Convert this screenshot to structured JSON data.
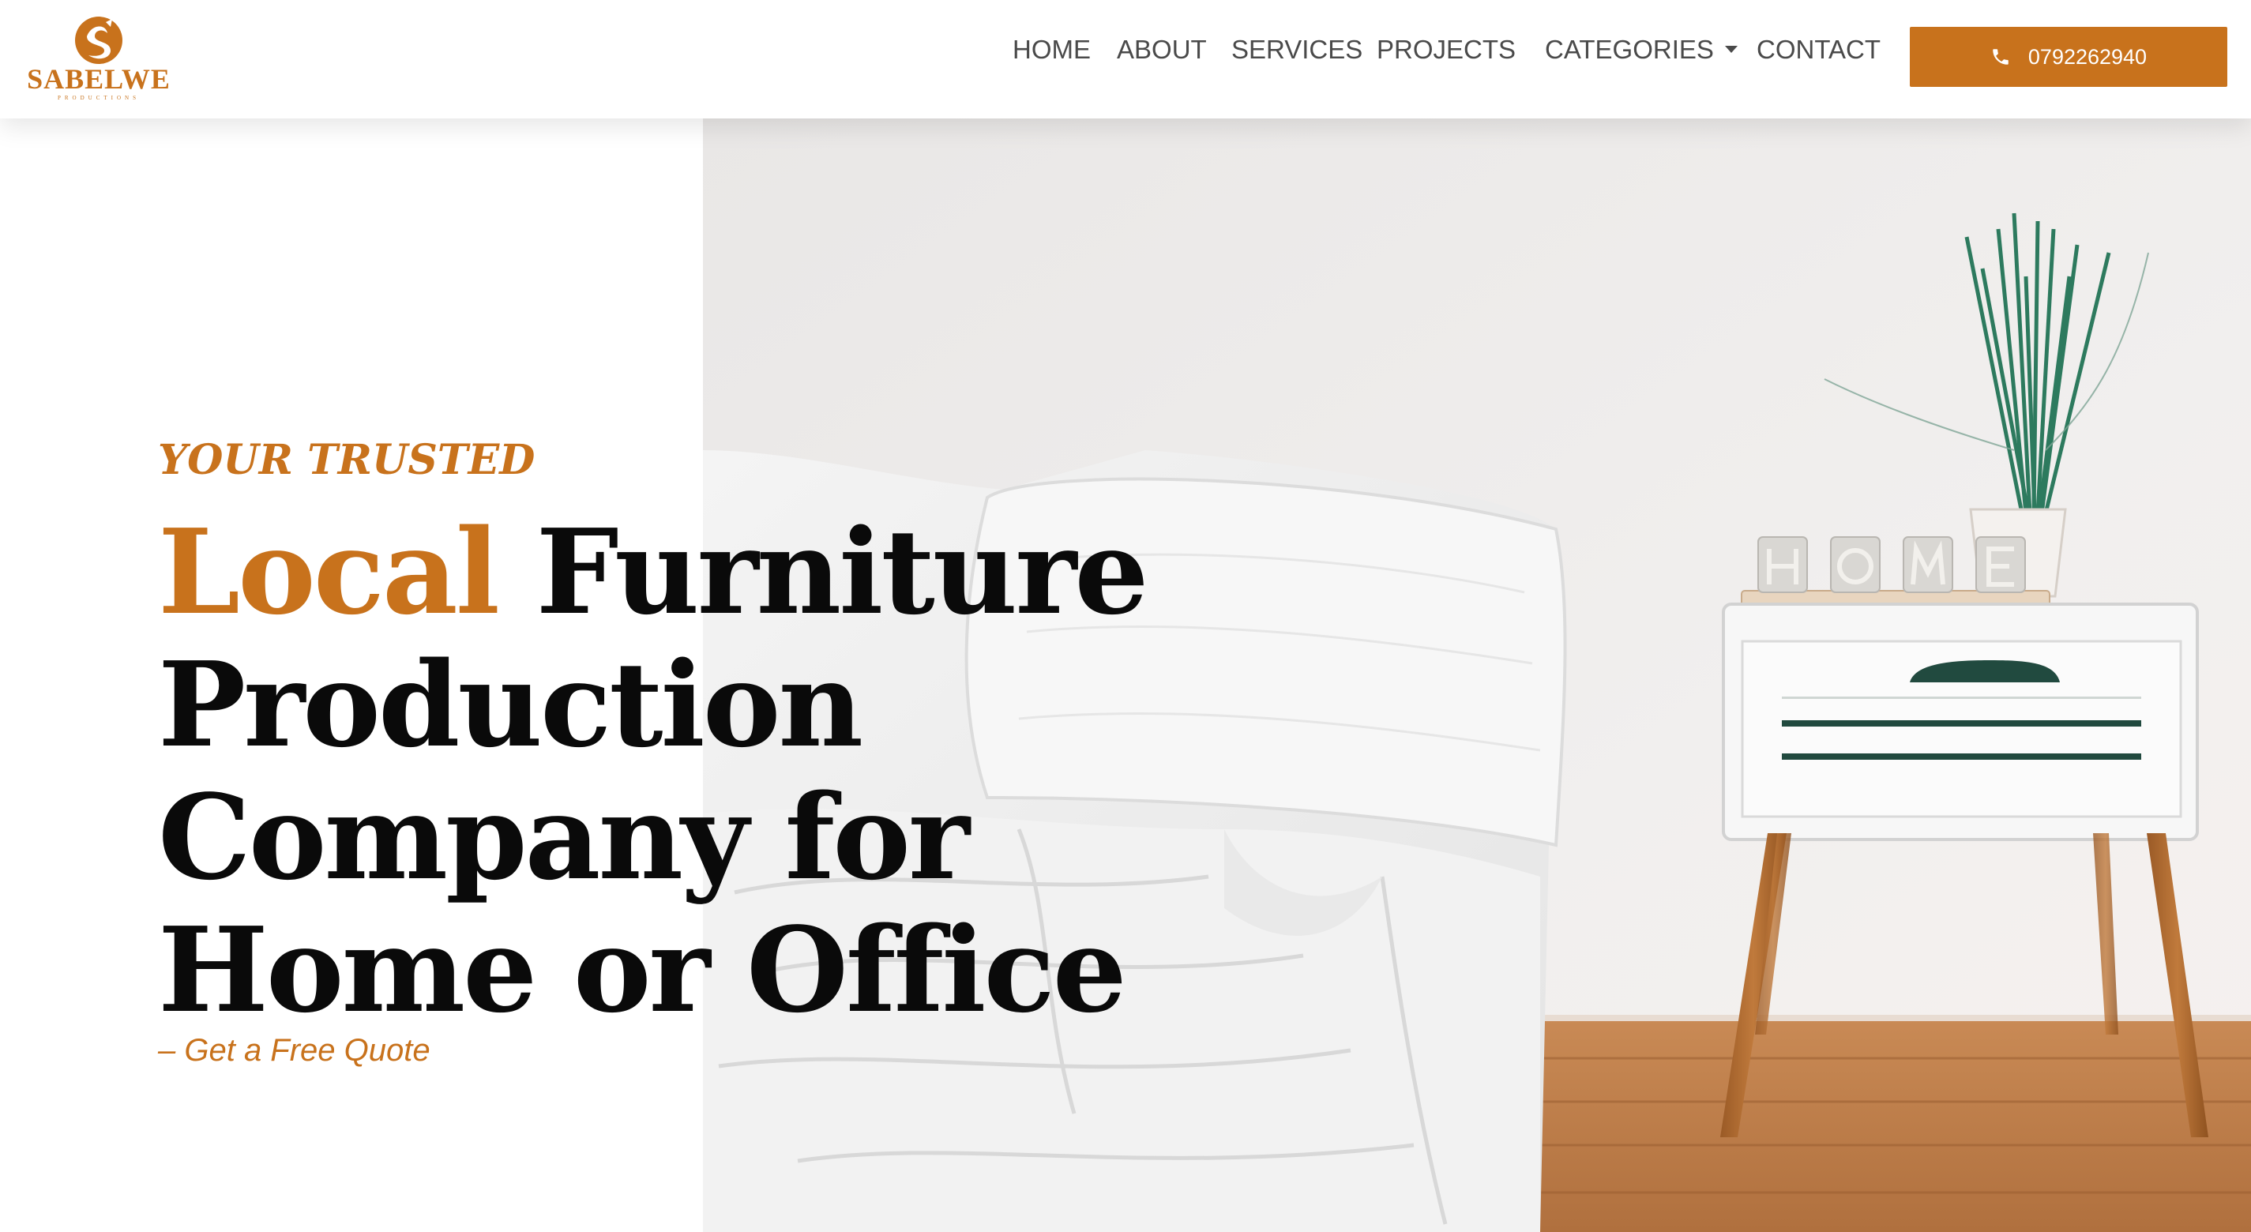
{
  "brand": {
    "name": "SABELWE",
    "tagline": "PRODUCTIONS",
    "accent_color": "#c8721c"
  },
  "nav": {
    "home": "HOME",
    "about": "ABOUT",
    "services": "SERVICES",
    "projects": "PROJECTS",
    "categories": "CATEGORIES",
    "contact": "CONTACT"
  },
  "cta": {
    "phone": "0792262940",
    "icon": "phone-icon"
  },
  "hero": {
    "eyebrow": "YOUR TRUSTED",
    "headline_accent": "Local",
    "headline_rest": "Furniture Production Company for Home or Office",
    "quote_link": "– Get a Free Quote",
    "image_alt": "White bedding and bedside table with HOME cups and plant"
  }
}
